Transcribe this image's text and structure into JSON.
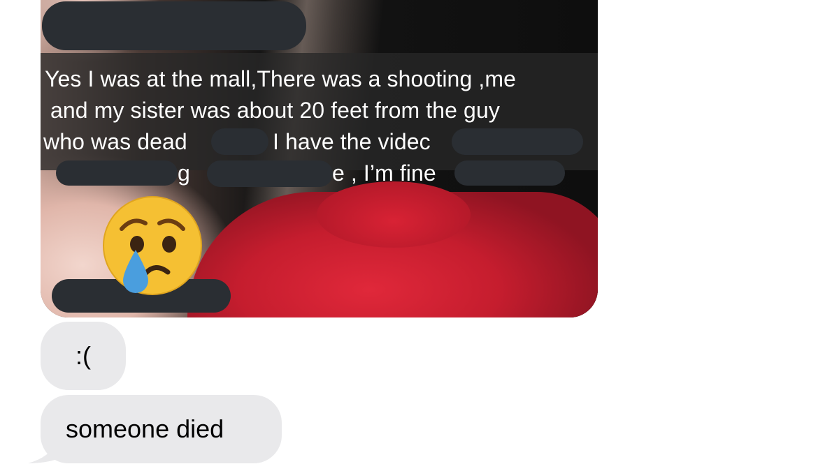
{
  "thread": {
    "photo_message": {
      "caption_lines": [
        "Yes I was at the mall,There was a shooting ,me",
        "and my sister was about 20 feet from the guy",
        "who was dead",
        "I have the videc",
        "g",
        "e , I’m fine"
      ],
      "emoji": "crying-face-emoji"
    },
    "messages": [
      {
        "text": ":("
      },
      {
        "text": "someone died"
      }
    ]
  },
  "colors": {
    "received_bubble": "#e9e9eb",
    "redaction": "#2a2e33",
    "caption_band": "#282828",
    "emoji_yellow": "#f5c033",
    "tear_blue": "#4a9ede"
  }
}
